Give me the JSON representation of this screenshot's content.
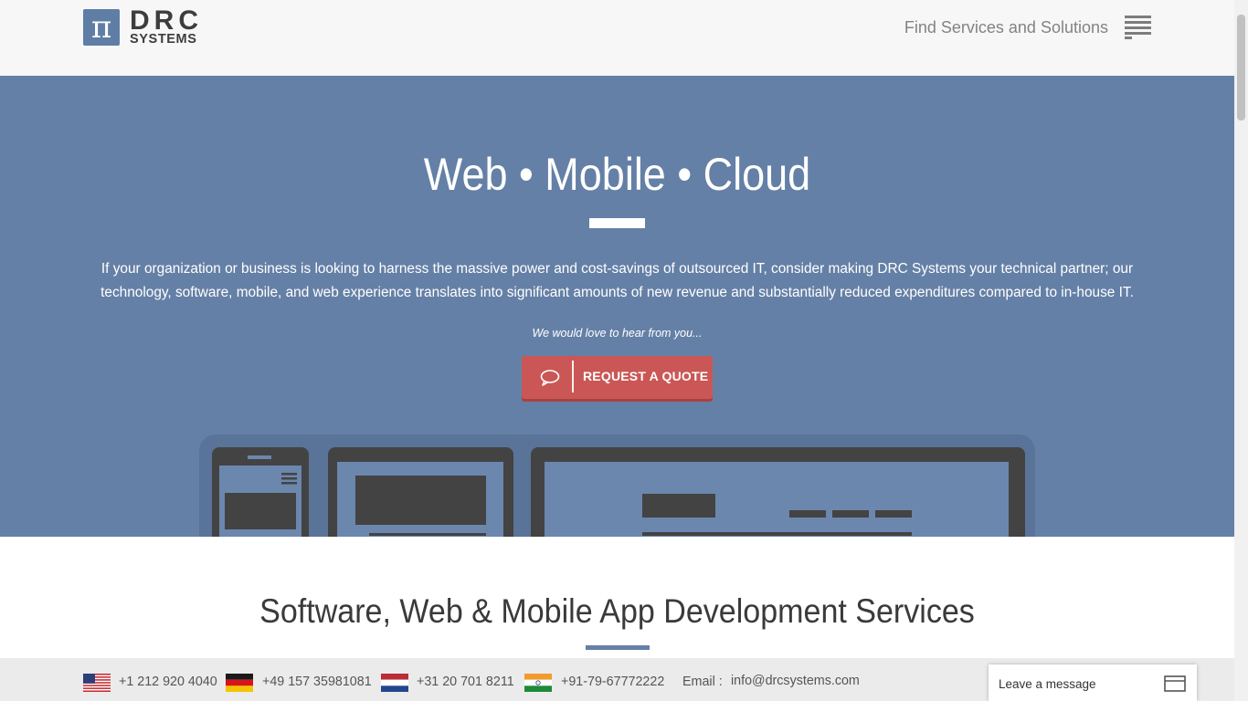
{
  "header": {
    "logo": {
      "symbol": "π",
      "brand_top": "DRC",
      "brand_bottom": "SYSTEMS"
    },
    "find_label": "Find Services and Solutions",
    "menu_icon": "hamburger-menu-icon"
  },
  "hero": {
    "title": "Web • Mobile • Cloud",
    "description": "If your organization or business is looking to harness the massive power and cost-savings of outsourced IT, consider making DRC Systems your technical partner; our technology, software, mobile, and web experience translates into significant amounts of new revenue and substantially reduced expenditures compared to in-house IT.",
    "tagline": "We would love to hear from you...",
    "cta_label": "REQUEST A QUOTE",
    "cta_icon": "chat-bubble-icon"
  },
  "section": {
    "title": "Software, Web & Mobile App Development Services"
  },
  "contact_bar": {
    "phones": [
      {
        "country": "us",
        "flag_icon": "us-flag-icon",
        "number": "+1 212 920 4040"
      },
      {
        "country": "de",
        "flag_icon": "de-flag-icon",
        "number": "+49 157 35981081"
      },
      {
        "country": "nl",
        "flag_icon": "nl-flag-icon",
        "number": "+31 20 701 8211"
      },
      {
        "country": "in",
        "flag_icon": "in-flag-icon",
        "number": "+91-79-67772222"
      }
    ],
    "email_label": "Email :",
    "email": "info@drcsystems.com"
  },
  "chat_widget": {
    "label": "Leave a message",
    "icon": "message-window-icon"
  },
  "colors": {
    "hero_bg": "#6580a6",
    "cta_bg": "#ca5755",
    "header_bg": "#f7f7f7",
    "contact_bg": "#ebebeb"
  }
}
